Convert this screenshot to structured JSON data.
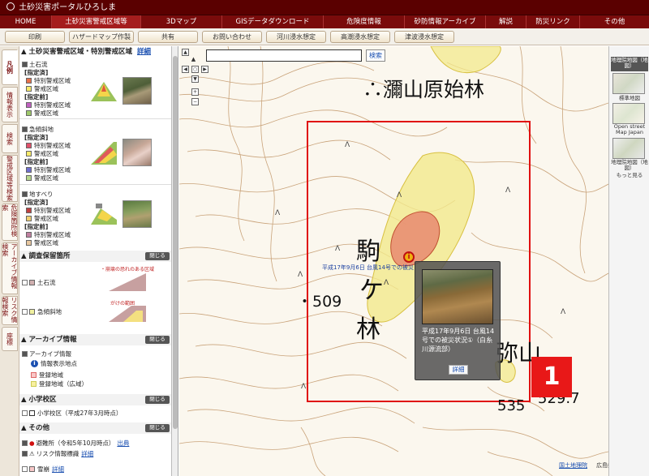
{
  "title": "土砂災害ポータルひろしま",
  "nav": [
    "HOME",
    "土砂災害警戒区域等",
    "3Dマップ",
    "GISデータダウンロード",
    "危険度情報",
    "砂防情報アーカイブ",
    "解説",
    "防災リンク",
    "その他"
  ],
  "toolbar": [
    "印刷",
    "ハザードマップ作製",
    "共有",
    "お問い合わせ",
    "河川浸水想定",
    "高潮浸水想定",
    "津波浸水想定"
  ],
  "sidetabs": [
    "凡例",
    "情報表示",
    "検索",
    "警戒区域等検索",
    "危険箇所検索",
    "アーカイブ情報検索",
    "リスク情報検索",
    "座標"
  ],
  "legend": {
    "section1_title": "土砂災害警戒区域・特別警戒区域",
    "detail": "詳細",
    "close": "閉じる",
    "dosekiryu": "土石流",
    "kyukeisha": "急傾斜地",
    "jisuberi": "地すべり",
    "shiteizumi": "[指定済]",
    "shiteimae": "[指定前]",
    "tokubetsu": "特別警戒区域",
    "keikai": "警戒区域",
    "section2_title": "調査保留箇所",
    "hold_dosekiryu": "土石流",
    "hold_kyukeisha": "急傾斜地",
    "hold_note1": "・崩壊の恐れのある区域",
    "hold_note2": "がけの範囲",
    "section3_title": "アーカイブ情報",
    "archive": "アーカイブ情報",
    "archive_point": "情報表示地点",
    "archive_area1": "登録地域",
    "archive_area2": "登録地域（広域）",
    "section4_title": "小学校区",
    "school": "小学校区（平成27年3月時点）",
    "section5_title": "その他",
    "shelter": "避難所（令和5年10月時点）",
    "shelter_link": "出典",
    "risk_sign": "リスク情報標識",
    "risk_link": "詳細",
    "snow": "雪崩",
    "snow_link": "詳細"
  },
  "map": {
    "search_placeholder": "",
    "search_button": "検索",
    "place1": "∴瀰山原始林",
    "place2a": "駒",
    "place2b": "ケ",
    "place2c": "林",
    "place3": "弥山",
    "elev1": "・509",
    "elev2": "535",
    "elev3": "529.7",
    "caption": "平成17年9月6日 台風14号での被災",
    "popup_text": "平成17年9月6日 台風14号での被災状況①（白糸川源流部）",
    "popup_button": "詳細",
    "badge": "1",
    "footer1": "国土地理院",
    "footer2": "広島県砂防課"
  },
  "rightbar": {
    "title": "地理院地図（地図）",
    "item1": "標準地図",
    "item2": "Open street Map Japan",
    "item3": "地理院地図（地図）",
    "more": "もっと見る"
  },
  "colors": {
    "title_bg": "#5a0000",
    "nav_bg": "#7a0b0b",
    "red_zone": "#e88a70",
    "yellow_zone": "#f3e98c",
    "badge": "#e81818",
    "frame": "#e01010"
  }
}
